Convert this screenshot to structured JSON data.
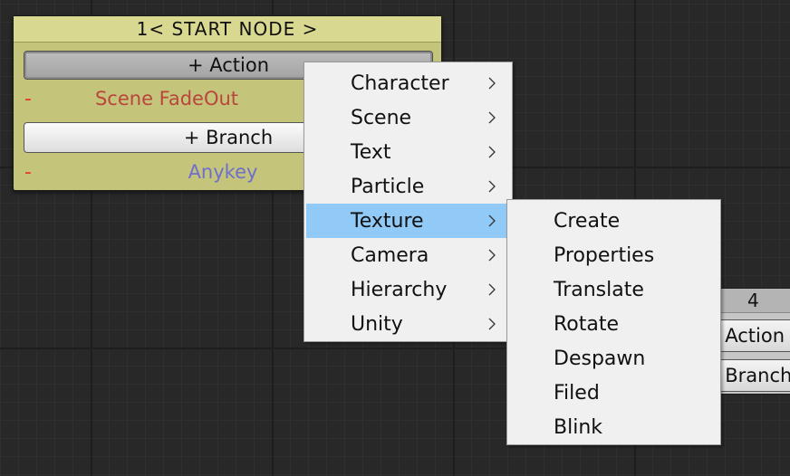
{
  "start_node": {
    "title": "1< START NODE >",
    "action_button": "+ Action",
    "actions": [
      {
        "remove": "-",
        "label": "Scene FadeOut",
        "color": "#b9463c"
      }
    ],
    "branch_button": "+ Branch",
    "branches": [
      {
        "remove": "-",
        "label": "Anykey",
        "color": "#6e6ecf"
      }
    ],
    "color": "#c4c47a"
  },
  "node4": {
    "title": "4",
    "action_button": "- Action",
    "branch_button": "- Branch"
  },
  "context_menu": {
    "items": [
      {
        "label": "Character",
        "submenu": true
      },
      {
        "label": "Scene",
        "submenu": true
      },
      {
        "label": "Text",
        "submenu": true
      },
      {
        "label": "Particle",
        "submenu": true
      },
      {
        "label": "Texture",
        "submenu": true,
        "highlighted": true
      },
      {
        "label": "Camera",
        "submenu": true
      },
      {
        "label": "Hierarchy",
        "submenu": true
      },
      {
        "label": "Unity",
        "submenu": true
      }
    ],
    "highlight_color": "#91c9f7"
  },
  "texture_submenu": {
    "items": [
      {
        "label": "Create"
      },
      {
        "label": "Properties"
      },
      {
        "label": "Translate"
      },
      {
        "label": "Rotate"
      },
      {
        "label": "Despawn"
      },
      {
        "label": "Filed"
      },
      {
        "label": "Blink"
      }
    ]
  }
}
